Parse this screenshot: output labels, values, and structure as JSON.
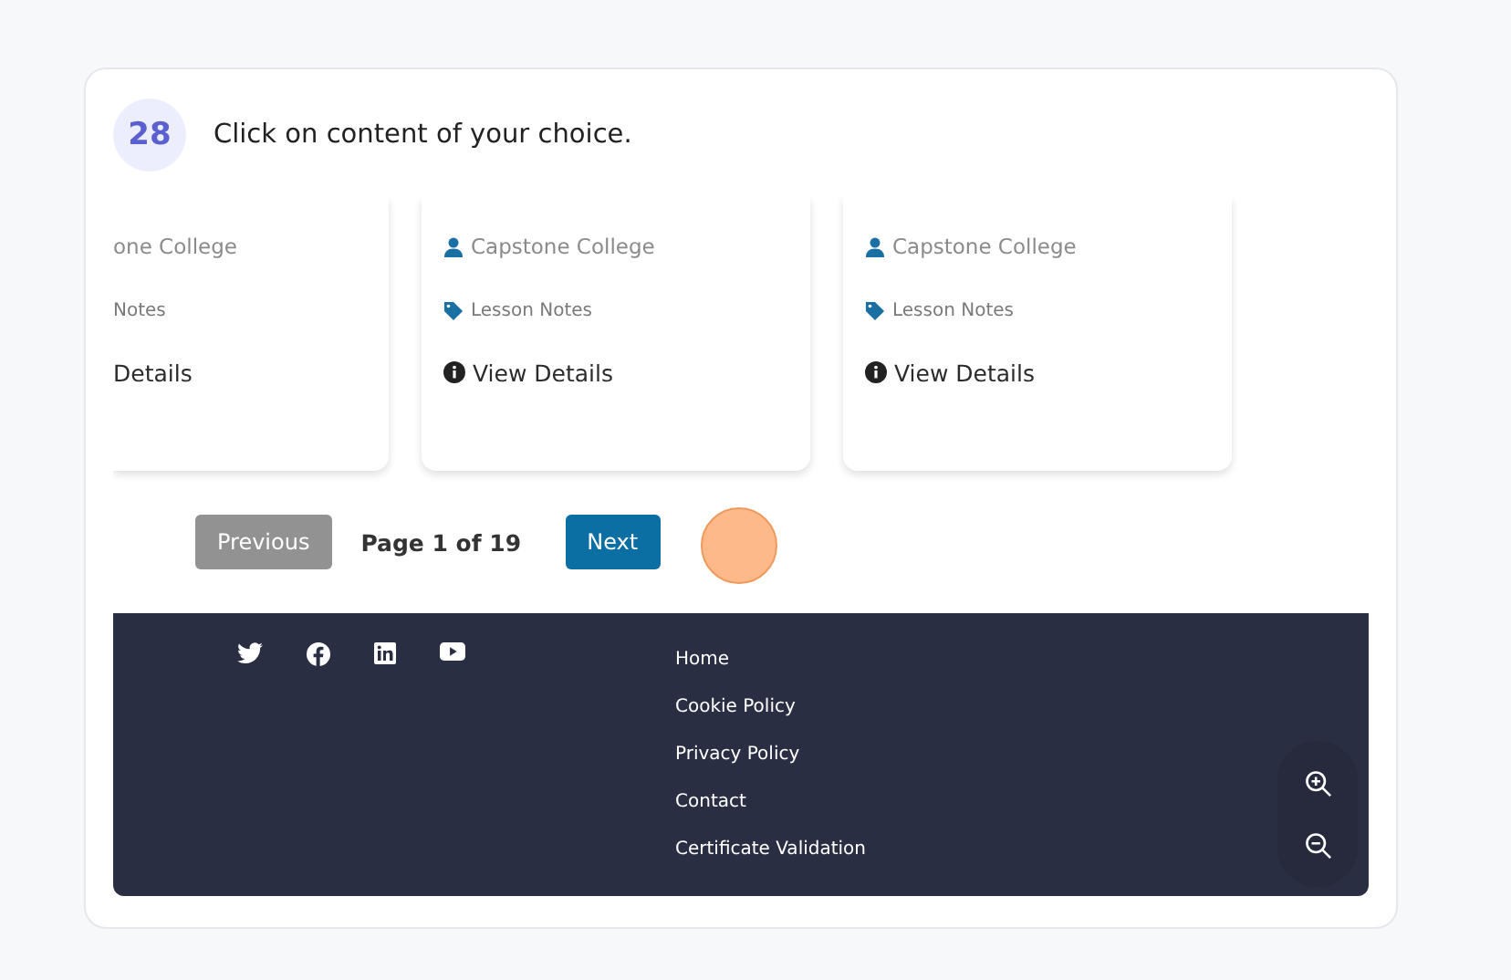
{
  "step": {
    "number": "28",
    "instruction": "Click on content of your choice."
  },
  "courses": [
    {
      "kind": "partial",
      "college": "one College",
      "category": "Notes",
      "link": "Details"
    },
    {
      "kind": "full",
      "college": "Capstone College",
      "category": "Lesson Notes",
      "link": "View Details"
    },
    {
      "kind": "full",
      "college": "Capstone College",
      "category": "Lesson Notes",
      "link": "View Details"
    }
  ],
  "pagination": {
    "previous": {
      "label": "Previous",
      "disabled": true
    },
    "page_label": "Page 1 of 19",
    "next": {
      "label": "Next",
      "disabled": false
    }
  },
  "footer": {
    "links": [
      "Home",
      "Cookie Policy",
      "Privacy Policy",
      "Contact",
      "Certificate Validation"
    ]
  }
}
